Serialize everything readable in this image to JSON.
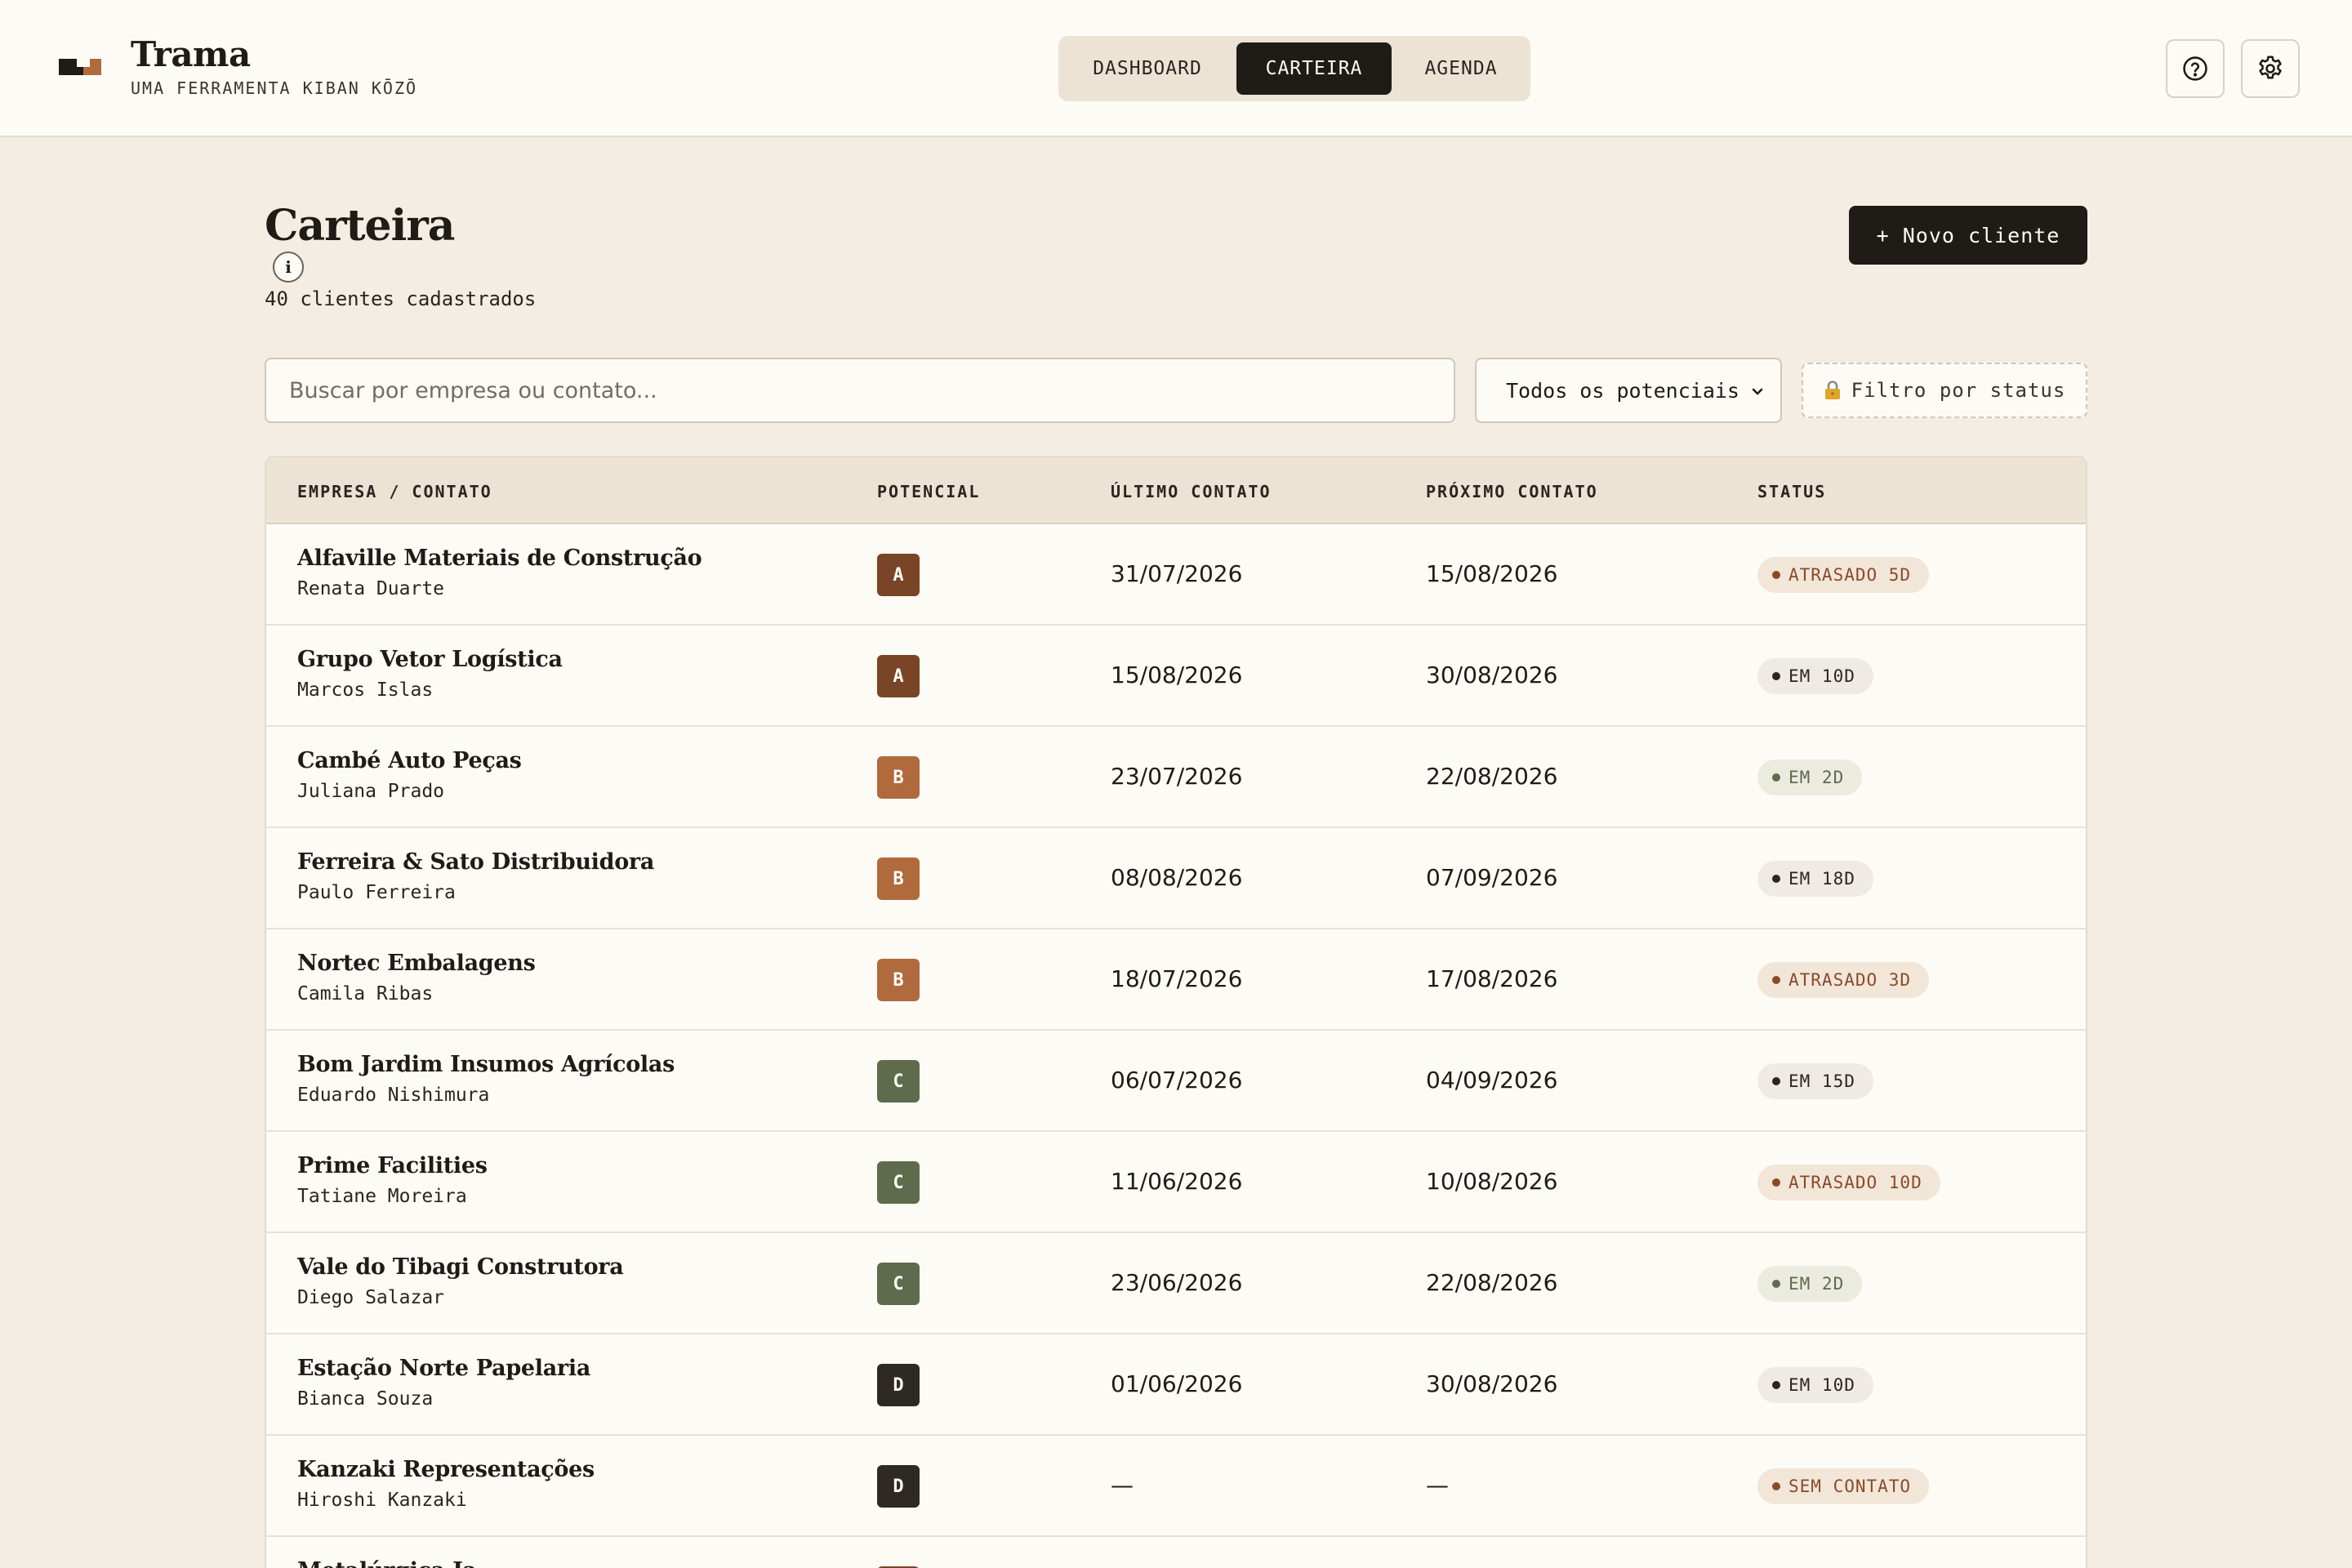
{
  "brand": {
    "name": "Trama",
    "subtitle": "UMA FERRAMENTA KIBAN KŌZŌ"
  },
  "nav": {
    "tabs": [
      "DASHBOARD",
      "CARTEIRA",
      "AGENDA"
    ],
    "active": "CARTEIRA"
  },
  "header_icons": [
    "help-icon",
    "gear-icon"
  ],
  "page": {
    "title": "Carteira",
    "info_label": "i",
    "count_text": "40 clientes cadastrados",
    "new_client_label": "+ Novo cliente"
  },
  "filters": {
    "search_placeholder": "Buscar por empresa ou contato...",
    "search_value": "",
    "potential_selected": "Todos os potenciais",
    "status_filter_label": "Filtro por status",
    "status_filter_icon": "lock-icon"
  },
  "table": {
    "headers": [
      "EMPRESA / CONTATO",
      "POTENCIAL",
      "ÚLTIMO CONTATO",
      "PRÓXIMO CONTATO",
      "STATUS"
    ],
    "rows": [
      {
        "company": "Alfaville Materiais de Construção",
        "contact": "Renata Duarte",
        "potential": "A",
        "last": "31/07/2026",
        "next": "15/08/2026",
        "status": "ATRASADO 5D",
        "status_kind": "late"
      },
      {
        "company": "Grupo Vetor Logística",
        "contact": "Marcos Islas",
        "potential": "A",
        "last": "15/08/2026",
        "next": "30/08/2026",
        "status": "EM 10D",
        "status_kind": "future"
      },
      {
        "company": "Cambé Auto Peças",
        "contact": "Juliana Prado",
        "potential": "B",
        "last": "23/07/2026",
        "next": "22/08/2026",
        "status": "EM 2D",
        "status_kind": "soon"
      },
      {
        "company": "Ferreira & Sato Distribuidora",
        "contact": "Paulo Ferreira",
        "potential": "B",
        "last": "08/08/2026",
        "next": "07/09/2026",
        "status": "EM 18D",
        "status_kind": "future"
      },
      {
        "company": "Nortec Embalagens",
        "contact": "Camila Ribas",
        "potential": "B",
        "last": "18/07/2026",
        "next": "17/08/2026",
        "status": "ATRASADO 3D",
        "status_kind": "late"
      },
      {
        "company": "Bom Jardim Insumos Agrícolas",
        "contact": "Eduardo Nishimura",
        "potential": "C",
        "last": "06/07/2026",
        "next": "04/09/2026",
        "status": "EM 15D",
        "status_kind": "future"
      },
      {
        "company": "Prime Facilities",
        "contact": "Tatiane Moreira",
        "potential": "C",
        "last": "11/06/2026",
        "next": "10/08/2026",
        "status": "ATRASADO 10D",
        "status_kind": "late"
      },
      {
        "company": "Vale do Tibagi Construtora",
        "contact": "Diego Salazar",
        "potential": "C",
        "last": "23/06/2026",
        "next": "22/08/2026",
        "status": "EM 2D",
        "status_kind": "soon"
      },
      {
        "company": "Estação Norte Papelaria",
        "contact": "Bianca Souza",
        "potential": "D",
        "last": "01/06/2026",
        "next": "30/08/2026",
        "status": "EM 10D",
        "status_kind": "future"
      },
      {
        "company": "Kanzaki Representações",
        "contact": "Hiroshi Kanzaki",
        "potential": "D",
        "last": "—",
        "next": "—",
        "status": "SEM CONTATO",
        "status_kind": "late"
      },
      {
        "company": "Metalúrgica Ja",
        "contact": "",
        "potential": "A",
        "last": "",
        "next": "",
        "status": "",
        "status_kind": "late"
      }
    ]
  },
  "colors": {
    "potential": {
      "A": "#7a4427",
      "B": "#b06a3c",
      "C": "#5e6b4c",
      "D": "#2e2925"
    },
    "status": {
      "late": {
        "bg": "#f1e6d8",
        "fg": "#8a4a2a"
      },
      "future": {
        "bg": "#efebe4",
        "fg": "#2c251f"
      },
      "soon": {
        "bg": "#ecebdf",
        "fg": "#5e6b4c"
      }
    }
  }
}
